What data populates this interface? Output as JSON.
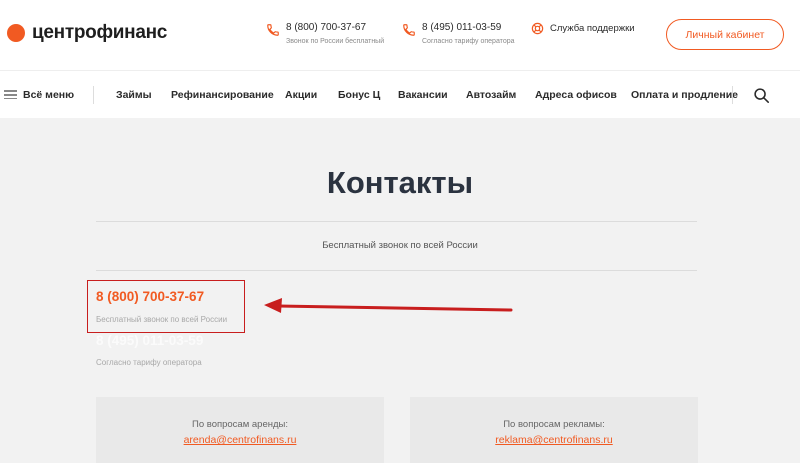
{
  "brand": {
    "name": "центрофинанс",
    "color": "#f15a22"
  },
  "header": {
    "phones": [
      {
        "number": "8 (800) 700-37-67",
        "caption": "Звонок по России бесплатный",
        "icon": "phone-icon"
      },
      {
        "number": "8 (495) 011-03-59",
        "caption": "Согласно тарифу оператора",
        "icon": "phone-icon"
      }
    ],
    "support_label": "Служба поддержки",
    "cabinet_label": "Личный кабинет"
  },
  "nav": {
    "menu_label": "Всё меню",
    "items": [
      "Займы",
      "Рефинансирование",
      "Акции",
      "Бонус Ц",
      "Вакансии",
      "Автозайм",
      "Адреса офисов",
      "Оплата и продление"
    ]
  },
  "main": {
    "title": "Контакты",
    "free_call_caption": "Бесплатный звонок по всей России",
    "phones": [
      {
        "number": "8 (800) 700-37-67",
        "caption": "Бесплатный звонок по всей России"
      },
      {
        "number": "8 (495) 011-03-59",
        "caption": "Согласно тарифу оператора"
      }
    ],
    "cards": [
      {
        "label": "По вопросам аренды:",
        "email": "arenda@centrofinans.ru"
      },
      {
        "label": "По вопросам рекламы:",
        "email": "reklama@centrofinans.ru"
      }
    ]
  },
  "annotation": {
    "color": "#c81e1e"
  }
}
